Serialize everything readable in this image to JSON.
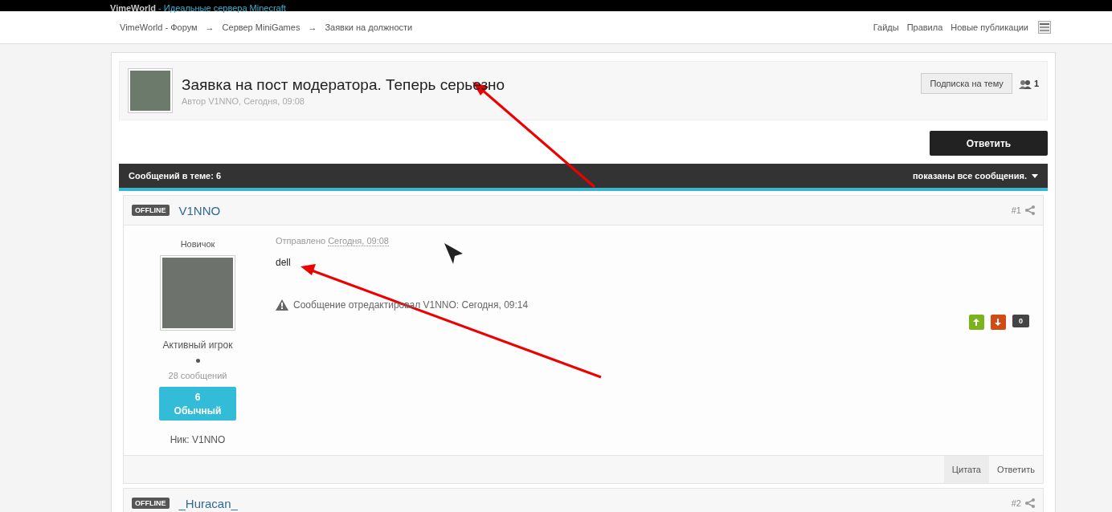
{
  "site_bar": {
    "brand": "VimeWorld",
    "tagline": " - Идеальные сервера Minecraft"
  },
  "breadcrumbs": [
    "VimeWorld - Форум",
    "Сервер MiniGames",
    "Заявки на должности"
  ],
  "breadcrumb_separator": "→",
  "top_links": [
    "Гайды",
    "Правила",
    "Новые публикации"
  ],
  "topic": {
    "title": "Заявка на пост модератора. Теперь серьезно",
    "meta": "Автор V1NNO, Сегодня, 09:08",
    "subscribe": "Подписка на тему",
    "followers": "1"
  },
  "reply_button": "Ответить",
  "posts_bar": {
    "count": "Сообщений в теме: 6",
    "filter": "показаны все сообщения."
  },
  "posts": [
    {
      "status": "OFFLINE",
      "author": "V1NNO",
      "number": "#1",
      "rank": "Новичок",
      "group": "Активный игрок",
      "post_count": "28 сообщений",
      "level": "6",
      "level_name": "Обычный",
      "nick": "Ник: V1NNO",
      "sent_label": "Отправлено",
      "sent_time": "Сегодня, 09:08",
      "body": "dell",
      "edited": "Сообщение отредактировал V1NNO: Сегодня, 09:14",
      "votes": "0",
      "actions": [
        "Цитата",
        "Ответить"
      ]
    },
    {
      "status": "OFFLINE",
      "author": "_Huracan_",
      "number": "#2"
    }
  ]
}
